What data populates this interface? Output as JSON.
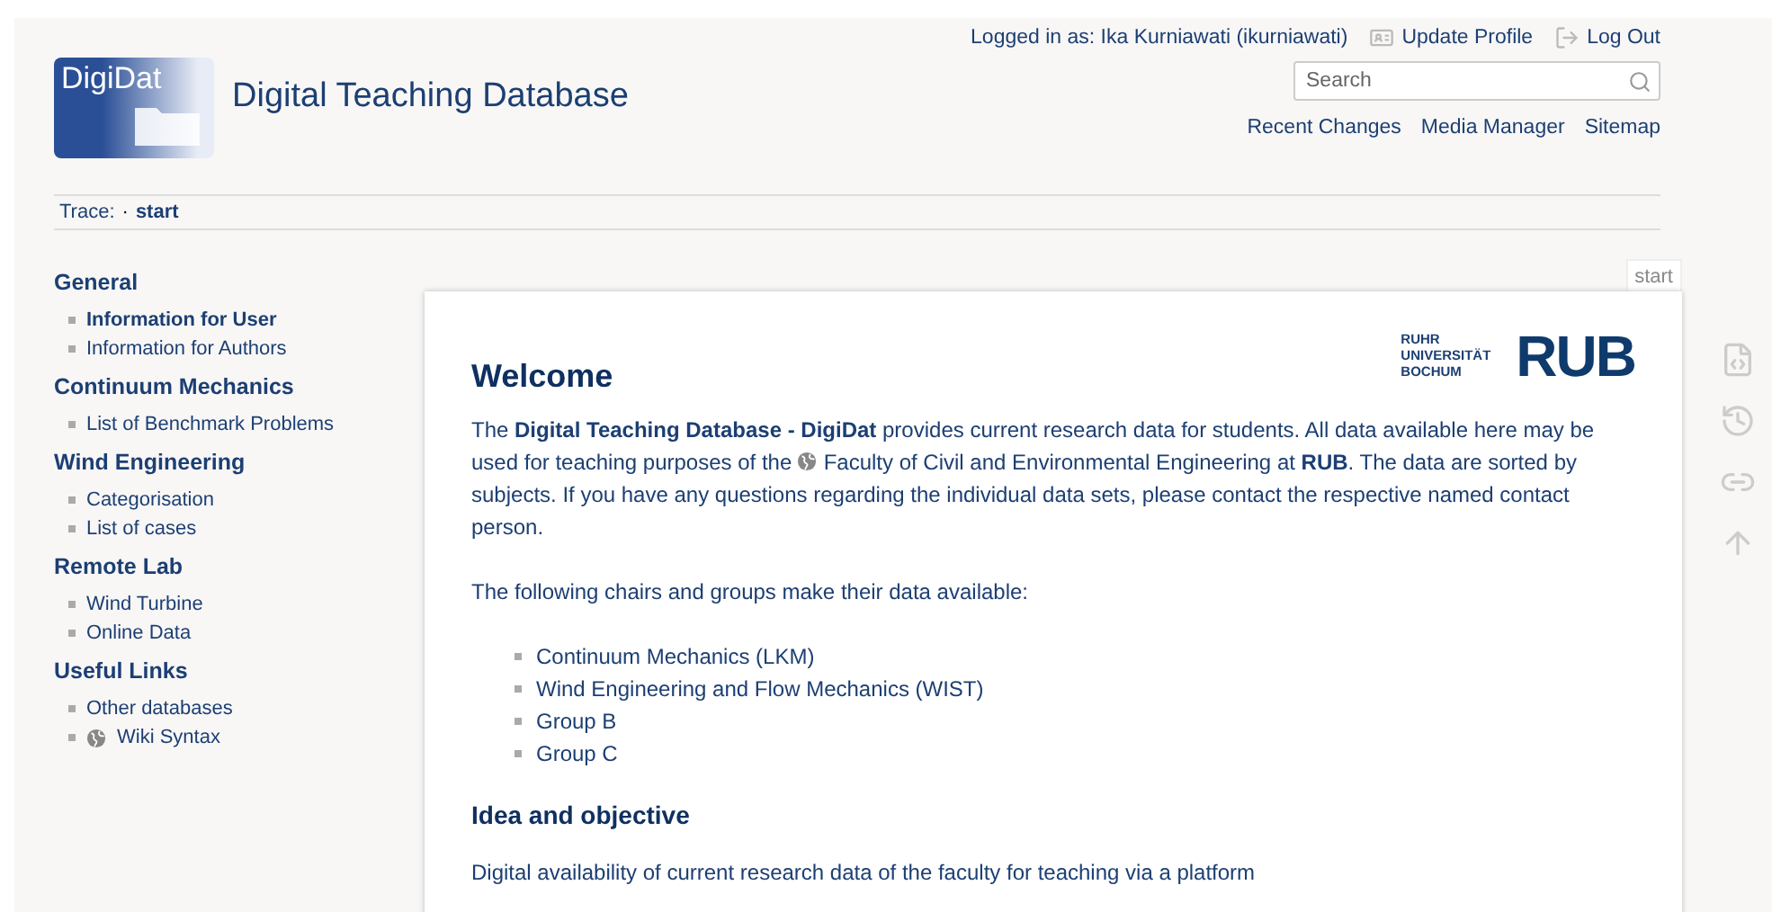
{
  "header": {
    "logo_text": "DigiDat",
    "title": "Digital Teaching Database",
    "user": "Logged in as: Ika Kurniawati (ikurniawati)",
    "user_links": [
      {
        "kind": "profile",
        "label": "Update Profile"
      },
      {
        "kind": "logout",
        "label": "Log Out"
      }
    ],
    "search": {
      "placeholder": "Search"
    },
    "nav": [
      "Recent Changes",
      "Media Manager",
      "Sitemap"
    ]
  },
  "trace": {
    "label": "Trace:",
    "separator": "·",
    "crumbs": [
      "start"
    ]
  },
  "sidebar": [
    {
      "heading": "General",
      "items": [
        {
          "label": "Information for User",
          "selected": true,
          "external": false
        },
        {
          "label": "Information for Authors",
          "selected": false,
          "external": false
        }
      ]
    },
    {
      "heading": "Continuum Mechanics",
      "items": [
        {
          "label": "List of Benchmark Problems",
          "selected": false,
          "external": false
        }
      ]
    },
    {
      "heading": "Wind Engineering",
      "items": [
        {
          "label": "Categorisation",
          "selected": false,
          "external": false
        },
        {
          "label": "List of cases",
          "selected": false,
          "external": false
        }
      ]
    },
    {
      "heading": "Remote Lab",
      "items": [
        {
          "label": "Wind Turbine",
          "selected": false,
          "external": false
        },
        {
          "label": "Online Data",
          "selected": false,
          "external": false
        }
      ]
    },
    {
      "heading": "Useful Links",
      "items": [
        {
          "label": "Other databases",
          "selected": false,
          "external": false
        },
        {
          "label": "Wiki Syntax",
          "selected": false,
          "external": true
        }
      ]
    }
  ],
  "page": {
    "tab": "start",
    "uni_logo": {
      "small": [
        "RUHR",
        "UNIVERSITÄT",
        "BOCHUM"
      ],
      "big": "RUB"
    },
    "title": "Welcome",
    "intro": {
      "before": "The **Digital Teaching Database - DigiDat** provides current research data for students. All data available here may be used for teaching purposes of the",
      "link": "Faculty of Civil and Environmental Engineering",
      "after": "at **RUB**. The data are sorted by subjects. If you have any questions regarding the individual data sets, please contact the respective named contact person."
    },
    "groups_intro": "The following chairs and groups make their data available:",
    "groups": [
      "Continuum Mechanics (LKM)",
      "Wind Engineering and Flow Mechanics (WIST)",
      "Group B",
      "Group C"
    ],
    "section": "Idea and objective",
    "section_text": "Digital availability of current research data of the faculty for teaching via a platform"
  }
}
